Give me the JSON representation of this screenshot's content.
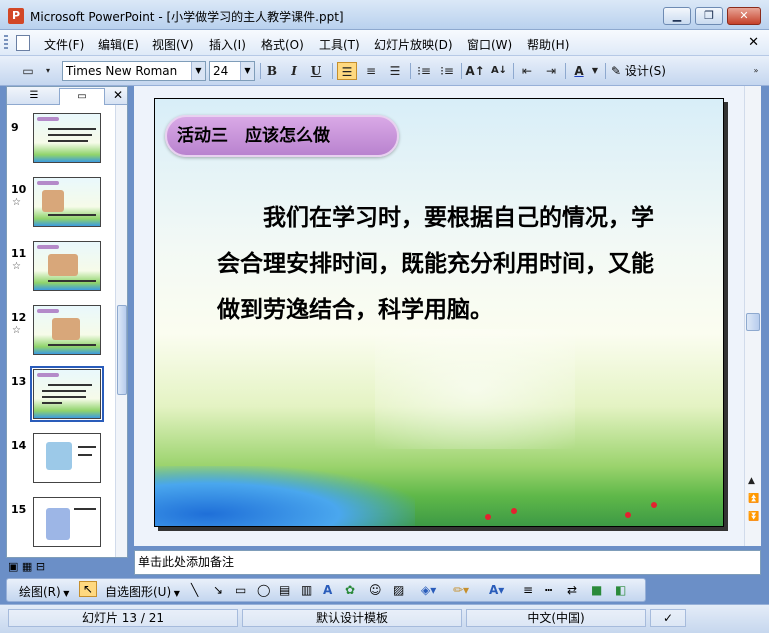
{
  "window": {
    "title": "Microsoft PowerPoint - [小学做学习的主人教学课件.ppt]",
    "minimize": "▁",
    "restore": "❐",
    "close": "✕"
  },
  "menu": {
    "items": [
      "文件(F)",
      "编辑(E)",
      "视图(V)",
      "插入(I)",
      "格式(O)",
      "工具(T)",
      "幻灯片放映(D)",
      "窗口(W)",
      "帮助(H)"
    ],
    "close": "✕"
  },
  "toolbar": {
    "font_name": "Times New Roman",
    "font_size": "24",
    "bold": "B",
    "italic": "I",
    "underline": "U",
    "design_label": "设计(S)"
  },
  "thumbnails": [
    {
      "num": "9",
      "star": ""
    },
    {
      "num": "10",
      "star": "☆"
    },
    {
      "num": "11",
      "star": "☆"
    },
    {
      "num": "12",
      "star": "☆"
    },
    {
      "num": "13",
      "star": ""
    },
    {
      "num": "14",
      "star": ""
    },
    {
      "num": "15",
      "star": ""
    }
  ],
  "slide": {
    "title": "活动三　应该怎么做",
    "body": "我们在学习时，要根据自己的情况，学会合理安排时间，既能充分利用时间，又能做到劳逸结合，科学用脑。"
  },
  "notes": {
    "placeholder": "单击此处添加备注"
  },
  "drawbar": {
    "draw_label": "绘图(R)",
    "autoshape_label": "自选图形(U)"
  },
  "status": {
    "slide_info": "幻灯片 13 / 21",
    "template": "默认设计模板",
    "language": "中文(中国)"
  }
}
